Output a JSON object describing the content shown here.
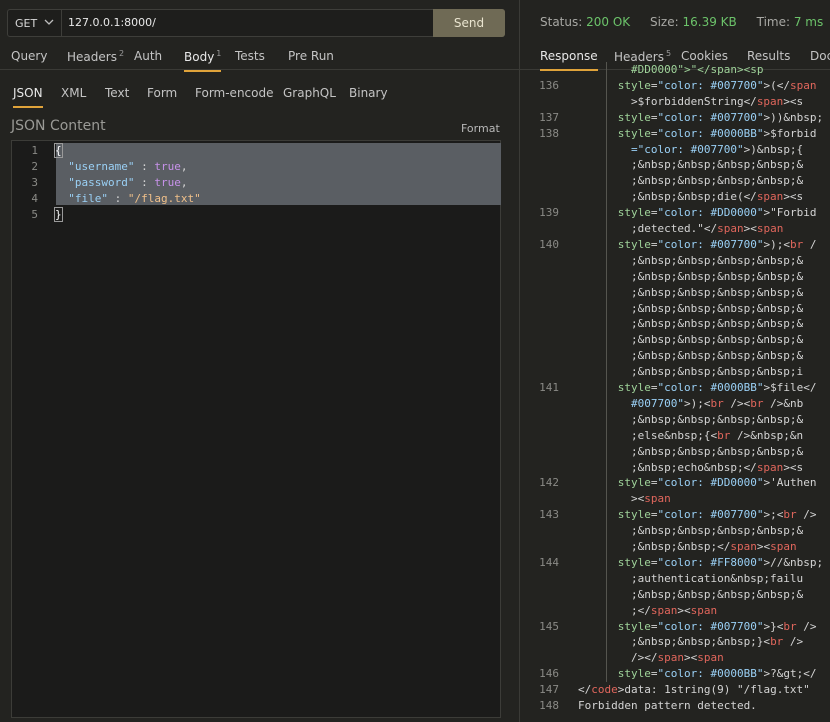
{
  "request": {
    "method": "GET",
    "url": "127.0.0.1:8000/",
    "send_label": "Send",
    "tabs": [
      {
        "label": "Query",
        "count": ""
      },
      {
        "label": "Headers",
        "count": "2"
      },
      {
        "label": "Auth",
        "count": ""
      },
      {
        "label": "Body",
        "count": "1"
      },
      {
        "label": "Tests",
        "count": ""
      },
      {
        "label": "Pre Run",
        "count": ""
      }
    ],
    "active_tab": "Body",
    "body_tabs": [
      "JSON",
      "XML",
      "Text",
      "Form",
      "Form-encode",
      "GraphQL",
      "Binary"
    ],
    "active_body_tab": "JSON",
    "json_label": "JSON Content",
    "format_label": "Format",
    "editor_lines": [
      {
        "num": "1",
        "tokens": [
          {
            "t": "{",
            "c": "brace"
          }
        ]
      },
      {
        "num": "2",
        "tokens": [
          {
            "t": "  ",
            "c": "p"
          },
          {
            "t": "\"username\"",
            "c": "k"
          },
          {
            "t": " : ",
            "c": "p"
          },
          {
            "t": "true",
            "c": "b"
          },
          {
            "t": ",",
            "c": "p"
          }
        ]
      },
      {
        "num": "3",
        "tokens": [
          {
            "t": "  ",
            "c": "p"
          },
          {
            "t": "\"password\"",
            "c": "k"
          },
          {
            "t": " : ",
            "c": "p"
          },
          {
            "t": "true",
            "c": "b"
          },
          {
            "t": ",",
            "c": "p"
          }
        ]
      },
      {
        "num": "4",
        "tokens": [
          {
            "t": "  ",
            "c": "p"
          },
          {
            "t": "\"file\"",
            "c": "k"
          },
          {
            "t": " : ",
            "c": "p"
          },
          {
            "t": "\"/flag.txt\"",
            "c": "s"
          }
        ]
      },
      {
        "num": "5",
        "tokens": [
          {
            "t": "}",
            "c": "brace"
          }
        ]
      }
    ]
  },
  "response": {
    "status_label": "Status:",
    "status_value": "200 OK",
    "size_label": "Size:",
    "size_value": "16.39 KB",
    "time_label": "Time:",
    "time_value": "7 ms",
    "tabs": [
      {
        "label": "Response",
        "count": ""
      },
      {
        "label": "Headers",
        "count": "5"
      },
      {
        "label": "Cookies",
        "count": ""
      },
      {
        "label": "Results",
        "count": ""
      },
      {
        "label": "Doc",
        "count": ""
      }
    ],
    "active_tab": "Response",
    "lines": [
      {
        "num": "",
        "bar": true,
        "tokens": [
          {
            "t": "        ",
            "c": "p"
          },
          {
            "t": "#DD0000\">\"</span><sp",
            "c": "attr"
          }
        ]
      },
      {
        "num": "136",
        "bar": true,
        "tokens": [
          {
            "t": "      ",
            "c": "p"
          },
          {
            "t": "style",
            "c": "attr"
          },
          {
            "t": "=",
            "c": "p"
          },
          {
            "t": "\"color: #007700\"",
            "c": "str"
          },
          {
            "t": ">(</",
            "c": "p"
          },
          {
            "t": "span",
            "c": "tag"
          }
        ]
      },
      {
        "num": "",
        "bar": true,
        "tokens": [
          {
            "t": "        >$forbiddenString</",
            "c": "p"
          },
          {
            "t": "span",
            "c": "tag"
          },
          {
            "t": "><s",
            "c": "p"
          }
        ]
      },
      {
        "num": "137",
        "bar": true,
        "tokens": [
          {
            "t": "      ",
            "c": "p"
          },
          {
            "t": "style",
            "c": "attr"
          },
          {
            "t": "=",
            "c": "p"
          },
          {
            "t": "\"color: #007700\"",
            "c": "str"
          },
          {
            "t": ">))&nbsp;",
            "c": "p"
          }
        ]
      },
      {
        "num": "138",
        "bar": true,
        "tokens": [
          {
            "t": "      ",
            "c": "p"
          },
          {
            "t": "style",
            "c": "attr"
          },
          {
            "t": "=",
            "c": "p"
          },
          {
            "t": "\"color: #0000BB\"",
            "c": "str"
          },
          {
            "t": ">$forbid",
            "c": "p"
          }
        ]
      },
      {
        "num": "",
        "bar": true,
        "tokens": [
          {
            "t": "        ",
            "c": "p"
          },
          {
            "t": "=\"color: #007700\"",
            "c": "str"
          },
          {
            "t": ">)&nbsp;{",
            "c": "p"
          }
        ]
      },
      {
        "num": "",
        "bar": true,
        "tokens": [
          {
            "t": "        ;&nbsp;&nbsp;&nbsp;&nbsp;&",
            "c": "p"
          }
        ]
      },
      {
        "num": "",
        "bar": true,
        "tokens": [
          {
            "t": "        ;&nbsp;&nbsp;&nbsp;&nbsp;&",
            "c": "p"
          }
        ]
      },
      {
        "num": "",
        "bar": true,
        "tokens": [
          {
            "t": "        ;&nbsp;&nbsp;die(</",
            "c": "p"
          },
          {
            "t": "span",
            "c": "tag"
          },
          {
            "t": "><s",
            "c": "p"
          }
        ]
      },
      {
        "num": "139",
        "bar": true,
        "tokens": [
          {
            "t": "      ",
            "c": "p"
          },
          {
            "t": "style",
            "c": "attr"
          },
          {
            "t": "=",
            "c": "p"
          },
          {
            "t": "\"color: #DD0000\"",
            "c": "str"
          },
          {
            "t": ">\"Forbid",
            "c": "p"
          }
        ]
      },
      {
        "num": "",
        "bar": true,
        "tokens": [
          {
            "t": "        ;detected.\"</",
            "c": "p"
          },
          {
            "t": "span",
            "c": "tag"
          },
          {
            "t": "><",
            "c": "p"
          },
          {
            "t": "span",
            "c": "tag"
          }
        ]
      },
      {
        "num": "140",
        "bar": true,
        "tokens": [
          {
            "t": "      ",
            "c": "p"
          },
          {
            "t": "style",
            "c": "attr"
          },
          {
            "t": "=",
            "c": "p"
          },
          {
            "t": "\"color: #007700\"",
            "c": "str"
          },
          {
            "t": ">);<",
            "c": "p"
          },
          {
            "t": "br",
            "c": "tag"
          },
          {
            "t": " /",
            "c": "p"
          }
        ]
      },
      {
        "num": "",
        "bar": true,
        "tokens": [
          {
            "t": "        ;&nbsp;&nbsp;&nbsp;&nbsp;&",
            "c": "p"
          }
        ]
      },
      {
        "num": "",
        "bar": true,
        "tokens": [
          {
            "t": "        ;&nbsp;&nbsp;&nbsp;&nbsp;&",
            "c": "p"
          }
        ]
      },
      {
        "num": "",
        "bar": true,
        "tokens": [
          {
            "t": "        ;&nbsp;&nbsp;&nbsp;&nbsp;&",
            "c": "p"
          }
        ]
      },
      {
        "num": "",
        "bar": true,
        "tokens": [
          {
            "t": "        ;&nbsp;&nbsp;&nbsp;&nbsp;&",
            "c": "p"
          }
        ]
      },
      {
        "num": "",
        "bar": true,
        "tokens": [
          {
            "t": "        ;&nbsp;&nbsp;&nbsp;&nbsp;&",
            "c": "p"
          }
        ]
      },
      {
        "num": "",
        "bar": true,
        "tokens": [
          {
            "t": "        ;&nbsp;&nbsp;&nbsp;&nbsp;&",
            "c": "p"
          }
        ]
      },
      {
        "num": "",
        "bar": true,
        "tokens": [
          {
            "t": "        ;&nbsp;&nbsp;&nbsp;&nbsp;&",
            "c": "p"
          }
        ]
      },
      {
        "num": "",
        "bar": true,
        "tokens": [
          {
            "t": "        ;&nbsp;&nbsp;&nbsp;&nbsp;i",
            "c": "p"
          }
        ]
      },
      {
        "num": "141",
        "bar": true,
        "tokens": [
          {
            "t": "      ",
            "c": "p"
          },
          {
            "t": "style",
            "c": "attr"
          },
          {
            "t": "=",
            "c": "p"
          },
          {
            "t": "\"color: #0000BB\"",
            "c": "str"
          },
          {
            "t": ">$file</",
            "c": "p"
          }
        ]
      },
      {
        "num": "",
        "bar": true,
        "tokens": [
          {
            "t": "        ",
            "c": "p"
          },
          {
            "t": "#007700\"",
            "c": "str"
          },
          {
            "t": ">);<",
            "c": "p"
          },
          {
            "t": "br",
            "c": "tag"
          },
          {
            "t": " /><",
            "c": "p"
          },
          {
            "t": "br",
            "c": "tag"
          },
          {
            "t": " />&nb",
            "c": "p"
          }
        ]
      },
      {
        "num": "",
        "bar": true,
        "tokens": [
          {
            "t": "        ;&nbsp;&nbsp;&nbsp;&nbsp;&",
            "c": "p"
          }
        ]
      },
      {
        "num": "",
        "bar": true,
        "tokens": [
          {
            "t": "        ;else&nbsp;{<",
            "c": "p"
          },
          {
            "t": "br",
            "c": "tag"
          },
          {
            "t": " />&nbsp;&n",
            "c": "p"
          }
        ]
      },
      {
        "num": "",
        "bar": true,
        "tokens": [
          {
            "t": "        ;&nbsp;&nbsp;&nbsp;&nbsp;&",
            "c": "p"
          }
        ]
      },
      {
        "num": "",
        "bar": true,
        "tokens": [
          {
            "t": "        ;&nbsp;echo&nbsp;</",
            "c": "p"
          },
          {
            "t": "span",
            "c": "tag"
          },
          {
            "t": "><s",
            "c": "p"
          }
        ]
      },
      {
        "num": "142",
        "bar": true,
        "tokens": [
          {
            "t": "      ",
            "c": "p"
          },
          {
            "t": "style",
            "c": "attr"
          },
          {
            "t": "=",
            "c": "p"
          },
          {
            "t": "\"color: #DD0000\"",
            "c": "str"
          },
          {
            "t": ">'Authen",
            "c": "p"
          }
        ]
      },
      {
        "num": "",
        "bar": true,
        "tokens": [
          {
            "t": "        ><",
            "c": "p"
          },
          {
            "t": "span",
            "c": "tag"
          }
        ]
      },
      {
        "num": "143",
        "bar": true,
        "tokens": [
          {
            "t": "      ",
            "c": "p"
          },
          {
            "t": "style",
            "c": "attr"
          },
          {
            "t": "=",
            "c": "p"
          },
          {
            "t": "\"color: #007700\"",
            "c": "str"
          },
          {
            "t": ">;<",
            "c": "p"
          },
          {
            "t": "br",
            "c": "tag"
          },
          {
            "t": " />",
            "c": "p"
          }
        ]
      },
      {
        "num": "",
        "bar": true,
        "tokens": [
          {
            "t": "        ;&nbsp;&nbsp;&nbsp;&nbsp;&",
            "c": "p"
          }
        ]
      },
      {
        "num": "",
        "bar": true,
        "tokens": [
          {
            "t": "        ;&nbsp;&nbsp;</",
            "c": "p"
          },
          {
            "t": "span",
            "c": "tag"
          },
          {
            "t": "><",
            "c": "p"
          },
          {
            "t": "span",
            "c": "tag"
          }
        ]
      },
      {
        "num": "144",
        "bar": true,
        "tokens": [
          {
            "t": "      ",
            "c": "p"
          },
          {
            "t": "style",
            "c": "attr"
          },
          {
            "t": "=",
            "c": "p"
          },
          {
            "t": "\"color: #FF8000\"",
            "c": "str"
          },
          {
            "t": ">//&nbsp;",
            "c": "p"
          }
        ]
      },
      {
        "num": "",
        "bar": true,
        "tokens": [
          {
            "t": "        ;authentication&nbsp;failu",
            "c": "p"
          }
        ]
      },
      {
        "num": "",
        "bar": true,
        "tokens": [
          {
            "t": "        ;&nbsp;&nbsp;&nbsp;&nbsp;&",
            "c": "p"
          }
        ]
      },
      {
        "num": "",
        "bar": true,
        "tokens": [
          {
            "t": "        ;</",
            "c": "p"
          },
          {
            "t": "span",
            "c": "tag"
          },
          {
            "t": "><",
            "c": "p"
          },
          {
            "t": "span",
            "c": "tag"
          }
        ]
      },
      {
        "num": "145",
        "bar": true,
        "tokens": [
          {
            "t": "      ",
            "c": "p"
          },
          {
            "t": "style",
            "c": "attr"
          },
          {
            "t": "=",
            "c": "p"
          },
          {
            "t": "\"color: #007700\"",
            "c": "str"
          },
          {
            "t": ">}<",
            "c": "p"
          },
          {
            "t": "br",
            "c": "tag"
          },
          {
            "t": " />",
            "c": "p"
          }
        ]
      },
      {
        "num": "",
        "bar": true,
        "tokens": [
          {
            "t": "        ;&nbsp;&nbsp;&nbsp;}<",
            "c": "p"
          },
          {
            "t": "br",
            "c": "tag"
          },
          {
            "t": " />",
            "c": "p"
          }
        ]
      },
      {
        "num": "",
        "bar": true,
        "tokens": [
          {
            "t": "        /></",
            "c": "p"
          },
          {
            "t": "span",
            "c": "tag"
          },
          {
            "t": "><",
            "c": "p"
          },
          {
            "t": "span",
            "c": "tag"
          }
        ]
      },
      {
        "num": "146",
        "bar": true,
        "tokens": [
          {
            "t": "      ",
            "c": "p"
          },
          {
            "t": "style",
            "c": "attr"
          },
          {
            "t": "=",
            "c": "p"
          },
          {
            "t": "\"color: #0000BB\"",
            "c": "str"
          },
          {
            "t": ">?&gt;</",
            "c": "p"
          }
        ]
      },
      {
        "num": "147",
        "bar": false,
        "tokens": [
          {
            "t": "</",
            "c": "p"
          },
          {
            "t": "code",
            "c": "tag"
          },
          {
            "t": ">data: 1string(9) \"/flag.txt\"",
            "c": "p"
          }
        ]
      },
      {
        "num": "148",
        "bar": false,
        "tokens": [
          {
            "t": "Forbidden pattern detected.",
            "c": "p"
          }
        ]
      }
    ]
  }
}
